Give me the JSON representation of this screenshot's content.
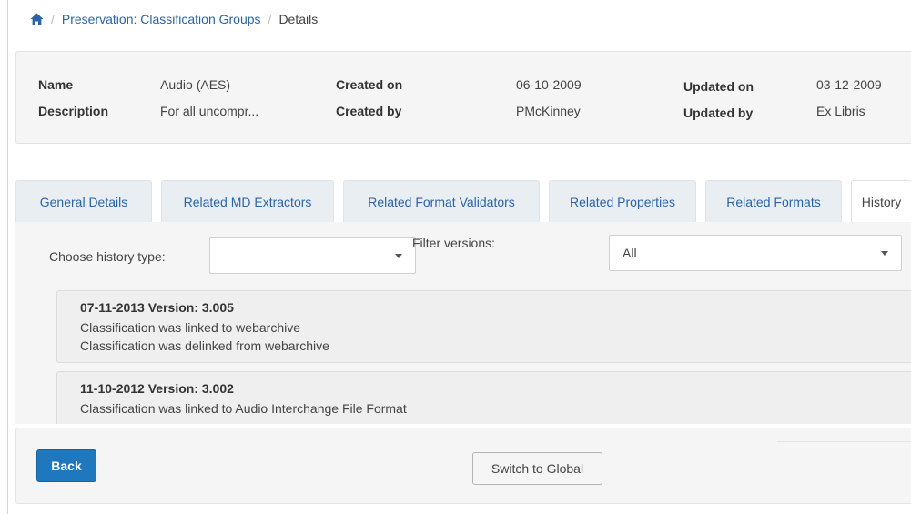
{
  "breadcrumb": {
    "home_icon": "home-icon",
    "separator": "/",
    "items": [
      "Preservation: Classification Groups",
      "Details"
    ]
  },
  "summary": {
    "name_label": "Name",
    "name_value": "Audio (AES)",
    "description_label": "Description",
    "description_value": "For all uncompr...",
    "created_on_label": "Created on",
    "created_on_value": "06-10-2009",
    "created_by_label": "Created by",
    "created_by_value": "PMcKinney",
    "updated_on_label": "Updated on",
    "updated_on_value": "03-12-2009",
    "updated_by_label": "Updated by",
    "updated_by_value": "Ex Libris"
  },
  "tabs": [
    {
      "label": "General Details",
      "active": false
    },
    {
      "label": "Related MD Extractors",
      "active": false
    },
    {
      "label": "Related Format Validators",
      "active": false
    },
    {
      "label": "Related Properties",
      "active": false
    },
    {
      "label": "Related Formats",
      "active": false
    },
    {
      "label": "History",
      "active": true
    }
  ],
  "filters": {
    "history_type_label": "Choose history type:",
    "history_type_value": "",
    "filter_versions_label": "Filter versions:",
    "filter_versions_value": "All"
  },
  "history": [
    {
      "title": "07-11-2013 Version: 3.005",
      "lines": [
        "Classification was linked to webarchive",
        "Classification was delinked from webarchive"
      ]
    },
    {
      "title": "11-10-2012 Version: 3.002",
      "lines": [
        "Classification was linked to Audio Interchange File Format"
      ]
    }
  ],
  "footer": {
    "back_label": "Back",
    "switch_label": "Switch to Global"
  },
  "colors": {
    "link": "#2b63a6",
    "primary_button": "#1f77bd",
    "panel_bg": "#f5f5f5",
    "tab_bg": "#e9eef3"
  }
}
